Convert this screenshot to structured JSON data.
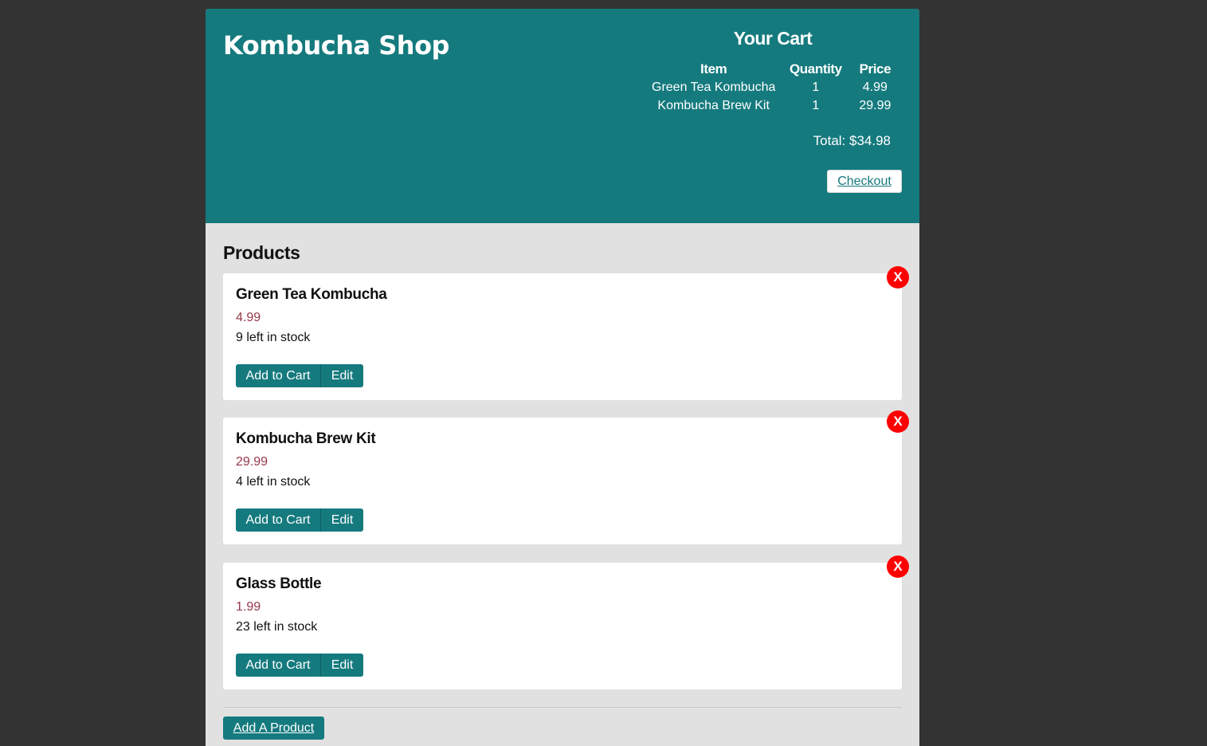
{
  "header": {
    "brand": "Kombucha Shop"
  },
  "cart": {
    "title": "Your Cart",
    "columns": {
      "item": "Item",
      "quantity": "Quantity",
      "price": "Price"
    },
    "rows": [
      {
        "item": "Green Tea Kombucha",
        "quantity": "1",
        "price": "4.99"
      },
      {
        "item": "Kombucha Brew Kit",
        "quantity": "1",
        "price": "29.99"
      }
    ],
    "total": "Total: $34.98",
    "checkout_label": "Checkout"
  },
  "products": {
    "heading": "Products",
    "items": [
      {
        "name": "Green Tea Kombucha",
        "price": "4.99",
        "stock": "9 left in stock"
      },
      {
        "name": "Kombucha Brew Kit",
        "price": "29.99",
        "stock": "4 left in stock"
      },
      {
        "name": "Glass Bottle",
        "price": "1.99",
        "stock": "23 left in stock"
      }
    ],
    "add_to_cart_label": "Add to Cart",
    "edit_label": "Edit",
    "delete_label": "X"
  },
  "footer": {
    "add_product_label": "Add A Product"
  },
  "colors": {
    "background": "#333333",
    "header": "#157a7e",
    "content": "#e1e1e1",
    "price": "#96374a",
    "delete": "#ff0000"
  }
}
